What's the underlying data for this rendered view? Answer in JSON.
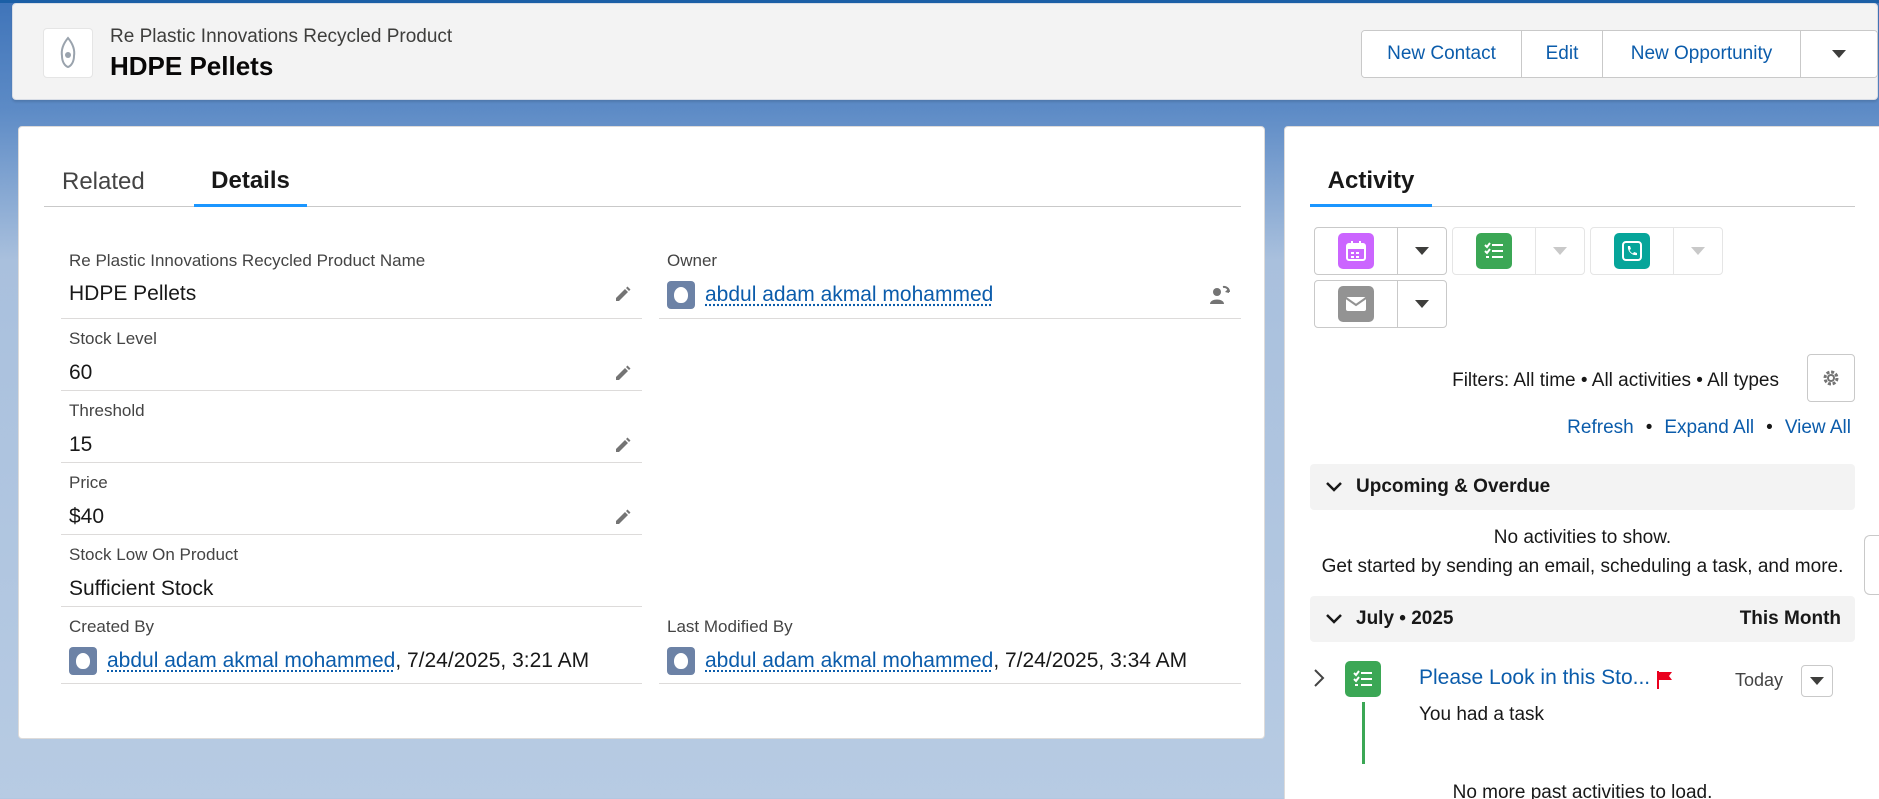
{
  "header": {
    "object_type": "Re Plastic Innovations Recycled Product",
    "title": "HDPE Pellets",
    "actions": [
      "New Contact",
      "Edit",
      "New Opportunity"
    ]
  },
  "tabs": {
    "related": "Related",
    "details": "Details"
  },
  "fields": {
    "name": {
      "label": "Re Plastic Innovations Recycled Product Name",
      "value": "HDPE Pellets"
    },
    "owner": {
      "label": "Owner",
      "value": "abdul adam akmal mohammed"
    },
    "stock_level": {
      "label": "Stock Level",
      "value": "60"
    },
    "threshold": {
      "label": "Threshold",
      "value": "15"
    },
    "price": {
      "label": "Price",
      "value": "$40"
    },
    "stock_low": {
      "label": "Stock Low On Product",
      "value": "Sufficient Stock"
    },
    "created_by": {
      "label": "Created By",
      "user": "abdul adam akmal mohammed",
      "date": ", 7/24/2025, 3:21 AM"
    },
    "last_modified_by": {
      "label": "Last Modified By",
      "user": "abdul adam akmal mohammed",
      "date": ", 7/24/2025, 3:34 AM"
    }
  },
  "activity": {
    "tab": "Activity",
    "filters": "Filters: All time • All activities • All types",
    "links": {
      "refresh": "Refresh",
      "expand_all": "Expand All",
      "view_all": "View All",
      "separator": "•"
    },
    "upcoming": {
      "title": "Upcoming & Overdue",
      "empty": "No activities to show.",
      "hint": "Get started by sending an email, scheduling a task, and more."
    },
    "month": {
      "title": "July • 2025",
      "badge": "This Month"
    },
    "task": {
      "title": "Please Look in this Sto...",
      "date": "Today",
      "subtitle": "You had a task"
    },
    "no_more": "No more past activities to load.",
    "icons": [
      "calendar-icon",
      "task-icon",
      "call-icon",
      "email-icon",
      "gear-icon",
      "flag-icon"
    ],
    "colors": {
      "event": "#cb65ff",
      "task": "#3ba755",
      "call": "#06a59a",
      "email": "#939393",
      "flag": "#ea001e"
    }
  }
}
